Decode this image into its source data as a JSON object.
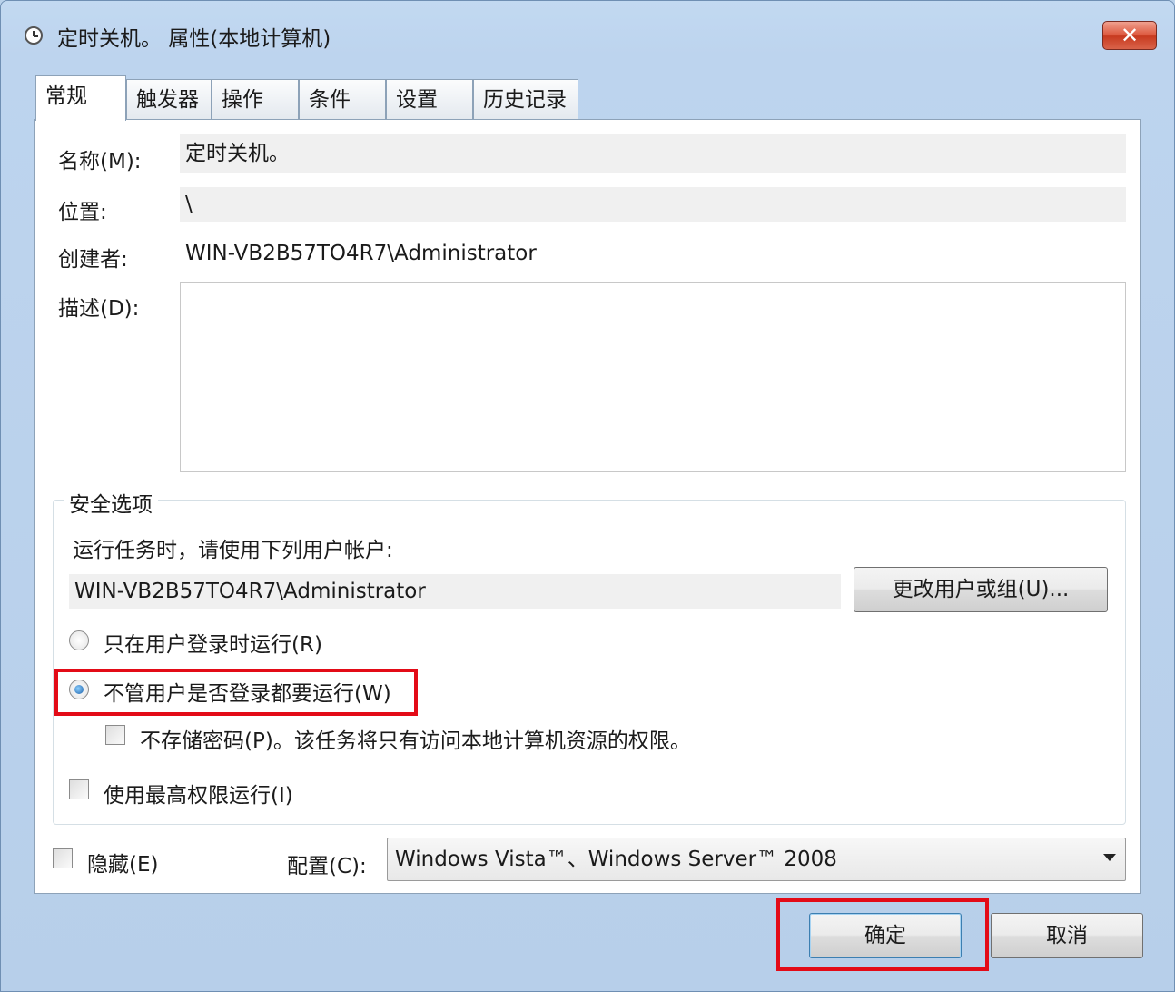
{
  "window": {
    "title": "定时关机。 属性(本地计算机)",
    "close_label": "✕"
  },
  "tabs": [
    {
      "label": "常规"
    },
    {
      "label": "触发器"
    },
    {
      "label": "操作"
    },
    {
      "label": "条件"
    },
    {
      "label": "设置"
    },
    {
      "label": "历史记录"
    }
  ],
  "general": {
    "name_label": "名称(M):",
    "name_value": "定时关机。",
    "location_label": "位置:",
    "location_value": "\\",
    "author_label": "创建者:",
    "author_value": "WIN-VB2B57TO4R7\\Administrator",
    "description_label": "描述(D):",
    "description_value": ""
  },
  "security": {
    "group_title": "安全选项",
    "run_as_prompt": "运行任务时，请使用下列用户帐户:",
    "user_account": "WIN-VB2B57TO4R7\\Administrator",
    "change_user_button": "更改用户或组(U)...",
    "radio_logged_on_only": "只在用户登录时运行(R)",
    "radio_whether_logged_on": "不管用户是否登录都要运行(W)",
    "selected_radio": "whether_logged_on",
    "no_store_password": "不存储密码(P)。该任务将只有访问本地计算机资源的权限。",
    "highest_privileges": "使用最高权限运行(I)"
  },
  "bottom": {
    "hidden_label": "隐藏(E)",
    "configure_label": "配置(C):",
    "configure_value": "Windows Vista™、Windows Server™ 2008"
  },
  "buttons": {
    "ok": "确定",
    "cancel": "取消"
  },
  "colors": {
    "highlight_box": "#e30b17",
    "titlebar": "#c2d9f1"
  }
}
